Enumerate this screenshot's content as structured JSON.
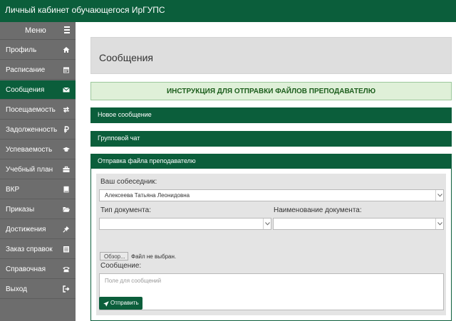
{
  "header": {
    "title": "Личный кабинет обучающегося ИрГУПС"
  },
  "sidebar": {
    "menu_label": "Меню",
    "items": [
      {
        "label": "Профиль",
        "icon": "home-icon"
      },
      {
        "label": "Расписание",
        "icon": "calendar-icon"
      },
      {
        "label": "Сообщения",
        "icon": "envelope-icon",
        "active": true
      },
      {
        "label": "Посещаемость",
        "icon": "swap-arrows-icon"
      },
      {
        "label": "Задолженность",
        "icon": "ruble-icon"
      },
      {
        "label": "Успеваемость",
        "icon": "graduation-cap-icon"
      },
      {
        "label": "Учебный план",
        "icon": "briefcase-icon"
      },
      {
        "label": "ВКР",
        "icon": "book-icon"
      },
      {
        "label": "Приказы",
        "icon": "folder-open-icon"
      },
      {
        "label": "Достижения",
        "icon": "pin-icon"
      },
      {
        "label": "Заказ справок",
        "icon": "list-icon"
      },
      {
        "label": "Справочная",
        "icon": "phone-icon"
      },
      {
        "label": "Выход",
        "icon": "sign-out-icon"
      }
    ]
  },
  "main": {
    "page_title": "Сообщения",
    "instruction_link": "ИНСТРУКЦИЯ ДЛЯ ОТПРАВКИ ФАЙЛОВ ПРЕПОДАВАТЕЛЮ",
    "panels": {
      "new_message": "Новое сообщение",
      "group_chat": "Групповой чат",
      "send_file": "Отправка файла преподавателю"
    },
    "form": {
      "interlocutor_label": "Ваш собеседник:",
      "interlocutor_value": "Алексеева Татьяна Леонидовна",
      "doc_type_label": "Тип документа:",
      "doc_type_value": "",
      "doc_name_label": "Наименование документа:",
      "doc_name_value": "",
      "file_button": "Обзор...",
      "file_status": "Файл не выбран.",
      "message_label": "Сообщение:",
      "message_placeholder": "Поле для сообщений",
      "submit_label": "Отправить"
    }
  },
  "colors": {
    "brand_green": "#0b5e3b",
    "sidebar_gray": "#6d6d6d",
    "instruction_bg": "#dff0d8"
  }
}
